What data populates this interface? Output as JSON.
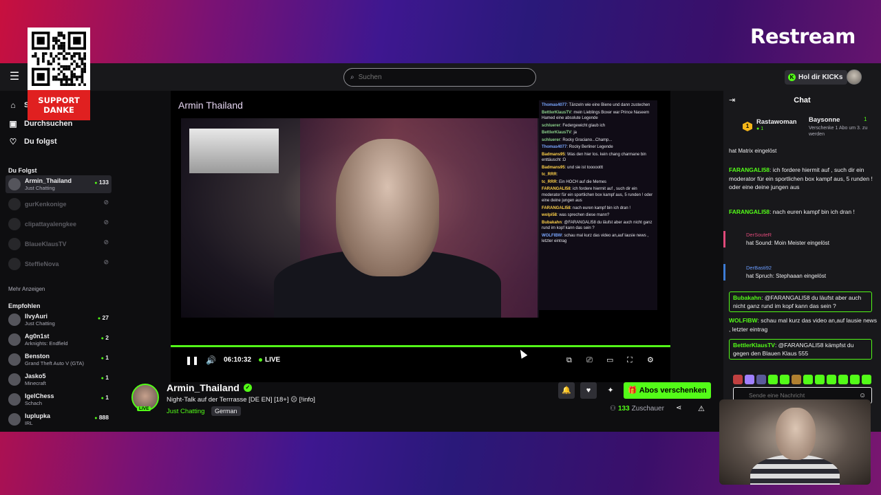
{
  "brand": "Restream",
  "topbar": {
    "search_placeholder": "Suchen",
    "kicks_label": "Hol dir KICKs"
  },
  "overlay": {
    "support_text_1": "SUPPORT",
    "support_text_2": "DANKE"
  },
  "sidebar": {
    "nav": [
      "S",
      "Durchsuchen",
      "Du folgst"
    ],
    "following_title": "Du Folgst",
    "following": [
      {
        "name": "Armin_Thailand",
        "game": "Just Chatting",
        "viewers": "133",
        "live": true
      },
      {
        "name": "gurKenkonige",
        "game": "",
        "viewers": "",
        "live": false
      },
      {
        "name": "clipattayalengkee",
        "game": "",
        "viewers": "",
        "live": false
      },
      {
        "name": "BlaueKlausTV",
        "game": "",
        "viewers": "",
        "live": false
      },
      {
        "name": "SteffieNova",
        "game": "",
        "viewers": "",
        "live": false
      }
    ],
    "more_label": "Mehr Anzeigen",
    "recommended_title": "Empfohlen",
    "recommended": [
      {
        "name": "IlvyAuri",
        "game": "Just Chatting",
        "viewers": "27"
      },
      {
        "name": "Ag0n1st",
        "game": "Arknights: Endfield",
        "viewers": "2"
      },
      {
        "name": "Benston",
        "game": "Grand Theft Auto V (GTA)",
        "viewers": "1"
      },
      {
        "name": "Jasko5",
        "game": "Minecraft",
        "viewers": "1"
      },
      {
        "name": "IgelChess",
        "game": "Schach",
        "viewers": "1"
      },
      {
        "name": "luplupka",
        "game": "IRL",
        "viewers": "888"
      }
    ]
  },
  "video": {
    "title_overlay": "Armin Thailand",
    "time": "06:10:32",
    "live_label": "LIVE",
    "progress": 1.0,
    "overlay_chat": [
      {
        "user": "Thomas4077",
        "text": ": Tänzeln wie eine Biene und dann zustechen"
      },
      {
        "user": "BettlerKlausTV",
        "text": ": mein Lieblings Boxer war Prince Naseem Hamed eine absolute Legende"
      },
      {
        "user": "schluerer",
        "text": ": Federgewicht glaub ich"
      },
      {
        "user": "BettlerKlausTV",
        "text": ": ja"
      },
      {
        "user": "schluerer",
        "text": ": Rocky Graciano...Champ..."
      },
      {
        "user": "Thomas4077",
        "text": ": Rocky Berliner Legende"
      },
      {
        "user": "Badmans95",
        "text": ": Was den hier los. kein chang charmane bin enttäuscht :D"
      },
      {
        "user": "Badmans95",
        "text": ": und sie ist tooooottt"
      },
      {
        "user": "tc_RRR",
        "text": ":"
      },
      {
        "user": "tc_RRR",
        "text": ": Ein HOCH auf die Memes"
      },
      {
        "user": "FARANGALI58",
        "text": ": ich fordere hiermit auf , such dir ein moderator für ein sportlichen box kampf aus, 5 runden ! oder eine deine jungen aus"
      },
      {
        "user": "FARANGALI58",
        "text": ": nach euren kampf bin ich dran !"
      },
      {
        "user": "wolpi58",
        "text": ": was sprechen diese mann?"
      },
      {
        "user": "Bubakahn",
        "text": ": @FARANGALI58 du läufst aber auch nicht ganz rund im kopf kann das sein ?"
      },
      {
        "user": "WOLFIBW",
        "text": ": schau mal kurz das video an,auf lausie news , letzter eintrag"
      }
    ]
  },
  "stream_info": {
    "name": "Armin_Thailand",
    "live_badge": "LIVE",
    "title": "Night-Talk auf der Terrrasse [DE EN] [18+] ☹ [!info]",
    "category": "Just Chatting",
    "language": "German",
    "subscribe_label": "Abos verschenken",
    "viewers_count": "133",
    "viewers_label": "Zuschauer"
  },
  "chat": {
    "title": "Chat",
    "pinned": {
      "user1": "Rastawoman",
      "user1_badge": "1",
      "user1_sub": "1",
      "user2": "Baysonne",
      "user2_count": "1",
      "user2_text": "Verschenke 1 Abo um 3. zu werden"
    },
    "messages": [
      {
        "kind": "system",
        "user": "",
        "text": "hat Matrix eingelöst"
      },
      {
        "kind": "msg",
        "user": "FARANGALI58",
        "text": ": ich fordere hiermit auf , such dir ein moderator für ein sportlichen box kampf aus, 5 runden ! oder eine deine jungen aus"
      },
      {
        "kind": "msg",
        "user": "FARANGALI58",
        "text": ": nach euren kampf bin ich dran !"
      },
      {
        "kind": "redeem",
        "user": "DerSouteR",
        "text": "hat Sound: Moin Meister eingelöst"
      },
      {
        "kind": "redeem",
        "user": "DerBasti92",
        "text": "hat Spruch: Stephaaan eingelöst"
      },
      {
        "kind": "hl",
        "user": "Bubakahn",
        "text": ": @FARANGALI58 du läufst aber auch nicht ganz rund im kopf kann das sein ?"
      },
      {
        "kind": "msg",
        "user": "WOLFIBW",
        "text": ": schau mal kurz das video an,auf lausie news , letzter eintrag"
      },
      {
        "kind": "hl",
        "user": "BettlerKlausTV",
        "text": ": @FARANGALI58 kämpfst du gegen den Blauen Klaus 555"
      }
    ],
    "input_placeholder": "Sende eine Nachricht"
  }
}
